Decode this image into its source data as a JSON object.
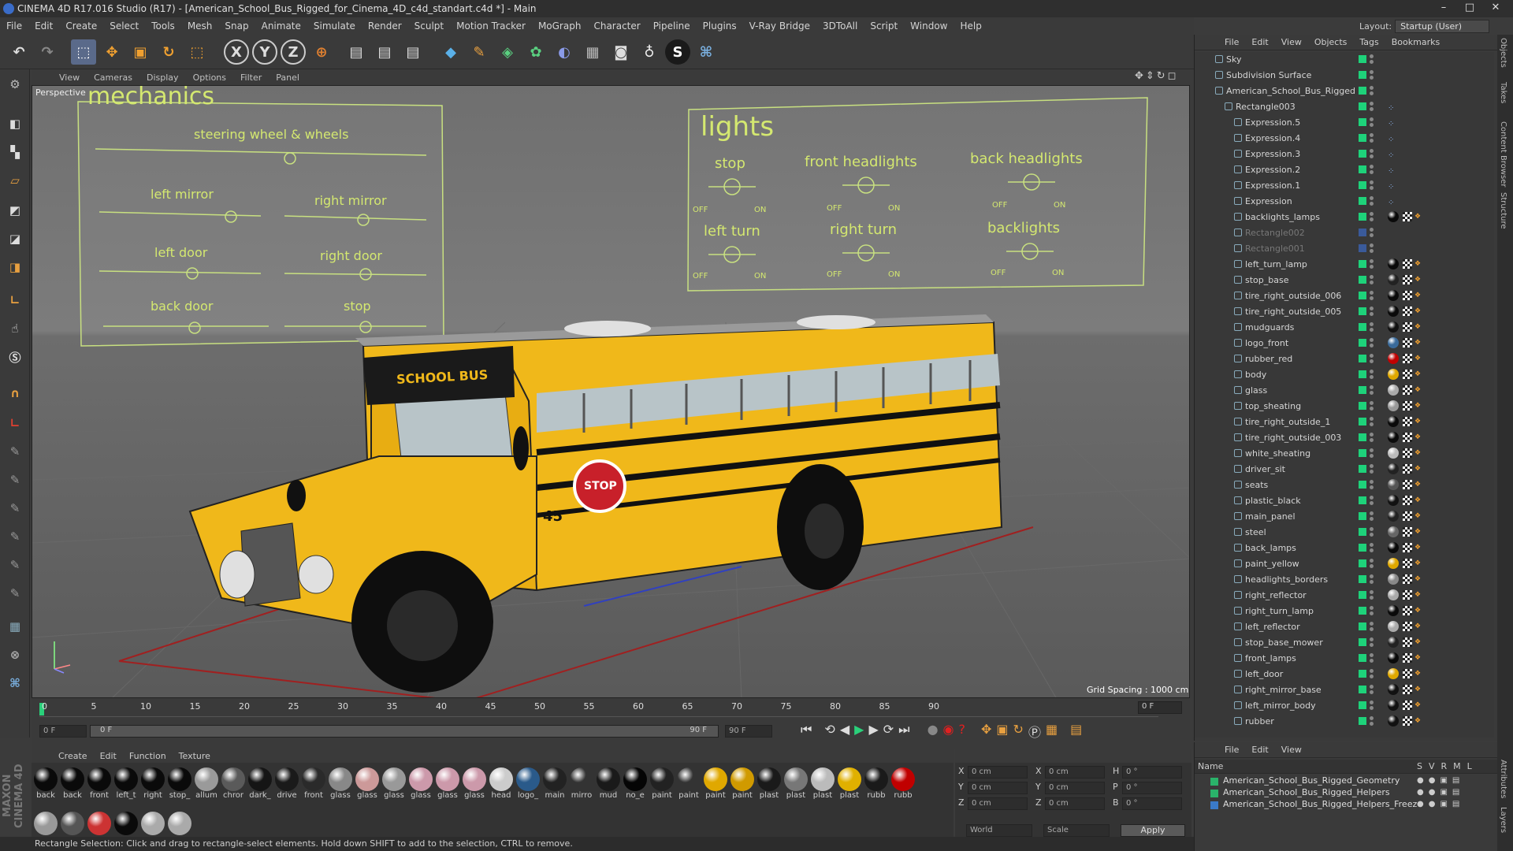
{
  "window": {
    "title": "CINEMA 4D R17.016 Studio (R17) - [American_School_Bus_Rigged_for_Cinema_4D_c4d_standart.c4d *] - Main",
    "layout_label": "Layout:",
    "layout_value": "Startup (User)"
  },
  "menubar": [
    "File",
    "Edit",
    "Create",
    "Select",
    "Tools",
    "Mesh",
    "Snap",
    "Animate",
    "Simulate",
    "Render",
    "Sculpt",
    "Motion Tracker",
    "MoGraph",
    "Character",
    "Pipeline",
    "Plugins",
    "V-Ray Bridge",
    "3DToAll",
    "Script",
    "Window",
    "Help"
  ],
  "viewport": {
    "menu": [
      "View",
      "Cameras",
      "Display",
      "Options",
      "Filter",
      "Panel"
    ],
    "label": "Perspective",
    "grid_spacing": "Grid Spacing : 1000 cm",
    "mechanics": {
      "title": "mechanics",
      "labels": [
        "steering wheel & wheels",
        "left mirror",
        "right mirror",
        "left door",
        "right door",
        "back door",
        "stop"
      ]
    },
    "lights": {
      "title": "lights",
      "labels": [
        "stop",
        "front headlights",
        "back  headlights",
        "left turn",
        "right turn",
        "backlights"
      ],
      "off": "OFF",
      "on": "ON"
    },
    "bus": {
      "sign": "SCHOOL BUS",
      "number": "45",
      "stop_sign": "STOP"
    }
  },
  "timeline": {
    "ticks": [
      "0",
      "5",
      "10",
      "15",
      "20",
      "25",
      "30",
      "35",
      "40",
      "45",
      "50",
      "55",
      "60",
      "65",
      "70",
      "75",
      "80",
      "85",
      "90"
    ],
    "current_frame": "0 F",
    "start_field": "0 F",
    "slider_start": "0 F",
    "slider_end": "90 F",
    "end_field": "90 F"
  },
  "materials": {
    "menu": [
      "Create",
      "Edit",
      "Function",
      "Texture"
    ],
    "row1": [
      {
        "n": "back",
        "c": "#0a0a0a"
      },
      {
        "n": "back",
        "c": "#0a0a0a"
      },
      {
        "n": "front",
        "c": "#0a0a0a"
      },
      {
        "n": "left_t",
        "c": "#0a0a0a"
      },
      {
        "n": "right",
        "c": "#0a0a0a"
      },
      {
        "n": "stop_",
        "c": "#0a0a0a"
      },
      {
        "n": "allum",
        "c": "#9a9a9a"
      },
      {
        "n": "chror",
        "c": "#5a5a5a"
      },
      {
        "n": "dark_",
        "c": "#151515"
      },
      {
        "n": "drive",
        "c": "#1a1a1a"
      },
      {
        "n": "front",
        "c": "#2a2a2a"
      },
      {
        "n": "glass",
        "c": "#888"
      },
      {
        "n": "glass",
        "c": "#c99"
      },
      {
        "n": "glass",
        "c": "#999"
      },
      {
        "n": "glass",
        "c": "#c9a"
      },
      {
        "n": "glass",
        "c": "#c9a"
      },
      {
        "n": "glass",
        "c": "#c9a"
      },
      {
        "n": "head",
        "c": "#ccc"
      },
      {
        "n": "logo_",
        "c": "#2a5a8a"
      },
      {
        "n": "main",
        "c": "#222"
      },
      {
        "n": "mirro",
        "c": "#333"
      },
      {
        "n": "mud",
        "c": "#1a1a1a"
      },
      {
        "n": "no_e",
        "c": "#050505"
      },
      {
        "n": "paint",
        "c": "#222"
      },
      {
        "n": "paint",
        "c": "#333"
      },
      {
        "n": "paint",
        "c": "#e0a800"
      },
      {
        "n": "paint",
        "c": "#d09a00"
      },
      {
        "n": "plast",
        "c": "#1a1a1a"
      },
      {
        "n": "plast",
        "c": "#777"
      },
      {
        "n": "plast",
        "c": "#bbb"
      },
      {
        "n": "plast",
        "c": "#e0b000"
      },
      {
        "n": "rubb",
        "c": "#1a1a1a"
      },
      {
        "n": "rubb",
        "c": "#c00000"
      }
    ],
    "row2": [
      {
        "c": "#999"
      },
      {
        "c": "#555"
      },
      {
        "c": "#c33"
      },
      {
        "c": "#0a0a0a"
      },
      {
        "c": "#aaa"
      },
      {
        "c": "#aaa"
      }
    ]
  },
  "coords": {
    "rows": [
      [
        "X",
        "0 cm",
        "X",
        "0 cm",
        "H",
        "0 °"
      ],
      [
        "Y",
        "0 cm",
        "Y",
        "0 cm",
        "P",
        "0 °"
      ],
      [
        "Z",
        "0 cm",
        "Z",
        "0 cm",
        "B",
        "0 °"
      ]
    ],
    "world": "World",
    "scale": "Scale",
    "apply": "Apply"
  },
  "status": "Rectangle Selection: Click and drag to rectangle-select elements. Hold down SHIFT to add to the selection, CTRL to remove.",
  "objmanager": {
    "menu": [
      "File",
      "Edit",
      "View",
      "Objects",
      "Tags",
      "Bookmarks"
    ],
    "objects": [
      {
        "n": "Sky",
        "i": 0,
        "t": ""
      },
      {
        "n": "Subdivision Surface",
        "i": 0,
        "t": ""
      },
      {
        "n": "American_School_Bus_Rigged",
        "i": 1,
        "t": ""
      },
      {
        "n": "Rectangle003",
        "i": 2,
        "t": "x"
      },
      {
        "n": "Expression.5",
        "i": 3,
        "t": "x"
      },
      {
        "n": "Expression.4",
        "i": 3,
        "t": "x"
      },
      {
        "n": "Expression.3",
        "i": 3,
        "t": "x"
      },
      {
        "n": "Expression.2",
        "i": 3,
        "t": "x"
      },
      {
        "n": "Expression.1",
        "i": 3,
        "t": "x"
      },
      {
        "n": "Expression",
        "i": 3,
        "t": "x"
      },
      {
        "n": "backlights_lamps",
        "i": 3,
        "t": "m",
        "c": "#0a0a0a"
      },
      {
        "n": "Rectangle002",
        "i": 3,
        "t": "",
        "dim": true
      },
      {
        "n": "Rectangle001",
        "i": 3,
        "t": "",
        "dim": true
      },
      {
        "n": "left_turn_lamp",
        "i": 3,
        "t": "m",
        "c": "#0a0a0a"
      },
      {
        "n": "stop_base",
        "i": 3,
        "t": "m",
        "c": "#222"
      },
      {
        "n": "tire_right_outside_006",
        "i": 3,
        "t": "mm",
        "c": "#0a0a0a"
      },
      {
        "n": "tire_right_outside_005",
        "i": 3,
        "t": "mm",
        "c": "#0a0a0a"
      },
      {
        "n": "mudguards",
        "i": 3,
        "t": "m",
        "c": "#111"
      },
      {
        "n": "logo_front",
        "i": 3,
        "t": "m",
        "c": "#3a6a9a"
      },
      {
        "n": "rubber_red",
        "i": 3,
        "t": "m",
        "c": "#c00000"
      },
      {
        "n": "body",
        "i": 3,
        "t": "m",
        "c": "#e0a800"
      },
      {
        "n": "glass",
        "i": 3,
        "t": "m",
        "c": "#aaa"
      },
      {
        "n": "top_sheating",
        "i": 3,
        "t": "m",
        "c": "#999"
      },
      {
        "n": "tire_right_outside_1",
        "i": 3,
        "t": "mm",
        "c": "#0a0a0a"
      },
      {
        "n": "tire_right_outside_003",
        "i": 3,
        "t": "mm",
        "c": "#0a0a0a"
      },
      {
        "n": "white_sheating",
        "i": 3,
        "t": "m",
        "c": "#bbb"
      },
      {
        "n": "driver_sit",
        "i": 3,
        "t": "m",
        "c": "#222"
      },
      {
        "n": "seats",
        "i": 3,
        "t": "m",
        "c": "#555"
      },
      {
        "n": "plastic_black",
        "i": 3,
        "t": "m",
        "c": "#111"
      },
      {
        "n": "main_panel",
        "i": 3,
        "t": "m",
        "c": "#222"
      },
      {
        "n": "steel",
        "i": 3,
        "t": "m",
        "c": "#666"
      },
      {
        "n": "back_lamps",
        "i": 3,
        "t": "m",
        "c": "#0a0a0a"
      },
      {
        "n": "paint_yellow",
        "i": 3,
        "t": "m",
        "c": "#e0a800"
      },
      {
        "n": "headlights_borders",
        "i": 3,
        "t": "m",
        "c": "#888"
      },
      {
        "n": "right_reflector",
        "i": 3,
        "t": "m",
        "c": "#aaa"
      },
      {
        "n": "right_turn_lamp",
        "i": 3,
        "t": "m",
        "c": "#0a0a0a"
      },
      {
        "n": "left_reflector",
        "i": 3,
        "t": "m",
        "c": "#aaa"
      },
      {
        "n": "stop_base_mower",
        "i": 3,
        "t": "mm",
        "c": "#222"
      },
      {
        "n": "front_lamps",
        "i": 3,
        "t": "m",
        "c": "#0a0a0a"
      },
      {
        "n": "left_door",
        "i": 3,
        "t": "mm",
        "c": "#e0a800"
      },
      {
        "n": "right_mirror_base",
        "i": 3,
        "t": "m",
        "c": "#111"
      },
      {
        "n": "left_mirror_body",
        "i": 3,
        "t": "mm",
        "c": "#111"
      },
      {
        "n": "rubber",
        "i": 3,
        "t": "m",
        "c": "#111"
      }
    ]
  },
  "layers": {
    "menu": [
      "File",
      "Edit",
      "View"
    ],
    "header": "Name",
    "cols": [
      "S",
      "V",
      "R",
      "M",
      "L"
    ],
    "items": [
      {
        "n": "American_School_Bus_Rigged_Geometry",
        "c": "#2ab36a"
      },
      {
        "n": "American_School_Bus_Rigged_Helpers",
        "c": "#2ab36a"
      },
      {
        "n": "American_School_Bus_Rigged_Helpers_Freeze",
        "c": "#3a7ac8"
      }
    ]
  },
  "sidetabs": [
    "Objects",
    "Takes",
    "Content Browser",
    "Structure",
    "Attributes",
    "Layers"
  ],
  "logo": "MAXON CINEMA 4D"
}
